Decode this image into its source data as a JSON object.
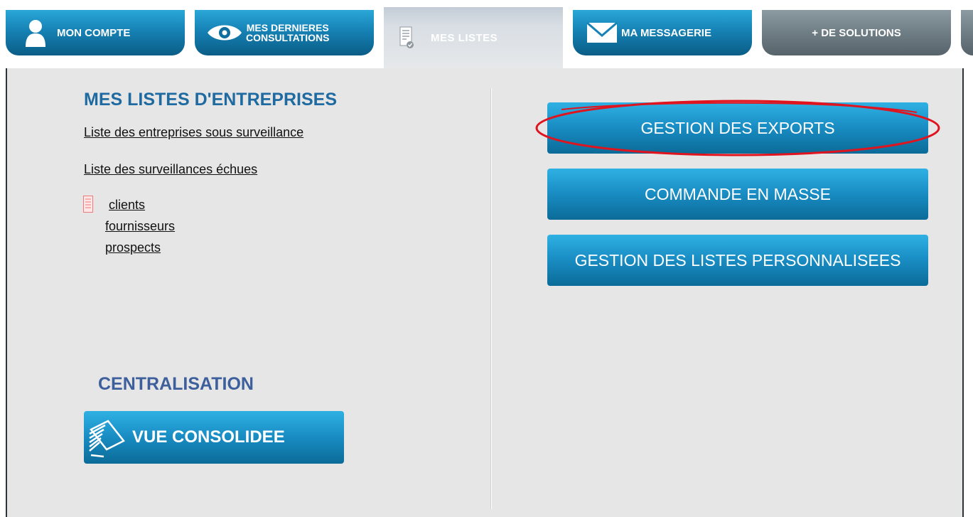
{
  "tabs": {
    "mon_compte": {
      "label": "MON COMPTE",
      "icon": "user-icon"
    },
    "consultations": {
      "label_line1": "MES DERNIERES",
      "label_line2": "CONSULTATIONS",
      "icon": "eye-icon"
    },
    "mes_listes": {
      "label": "MES LISTES",
      "icon": "document-list-icon",
      "active": true
    },
    "messagerie": {
      "label": "MA MESSAGERIE",
      "icon": "envelope-icon"
    },
    "solutions": {
      "label": "+ DE SOLUTIONS"
    }
  },
  "left": {
    "title": "MES LISTES D'ENTREPRISES",
    "links": {
      "surveillance": "Liste des entreprises sous surveillance",
      "echues": "Liste des surveillances échues"
    },
    "lists": [
      "clients",
      "fournisseurs",
      "prospects"
    ],
    "centralisation": {
      "title": "CENTRALISATION",
      "button_label": "VUE CONSOLIDEE"
    }
  },
  "right": {
    "buttons": {
      "exports": "GESTION DES EXPORTS",
      "commande": "COMMANDE EN MASSE",
      "listes": "GESTION DES LISTES PERSONNALISEES"
    }
  },
  "colors": {
    "accent_blue": "#1a8fc6",
    "title_blue": "#1f6aa0",
    "annotation_red": "#e0141e",
    "panel_bg": "#e6e6e6"
  }
}
